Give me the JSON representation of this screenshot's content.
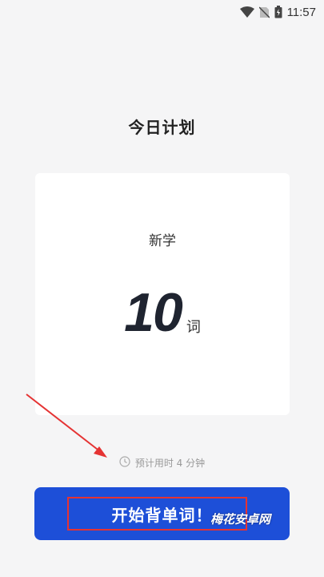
{
  "status_bar": {
    "time": "11:57",
    "icons": [
      "wifi-icon",
      "no-sim-icon",
      "battery-icon"
    ]
  },
  "page": {
    "title": "今日计划"
  },
  "plan_card": {
    "label": "新学",
    "count": "10",
    "unit": "词"
  },
  "estimate": {
    "icon": "clock-icon",
    "text": "预计用时 4 分钟"
  },
  "start_button": {
    "label": "开始背单词！"
  },
  "overlay": {
    "watermark": "梅花安卓网",
    "annotation_color": "#e53333"
  },
  "colors": {
    "primary": "#1d4fd8",
    "background": "#f5f5f6",
    "card": "#ffffff"
  }
}
